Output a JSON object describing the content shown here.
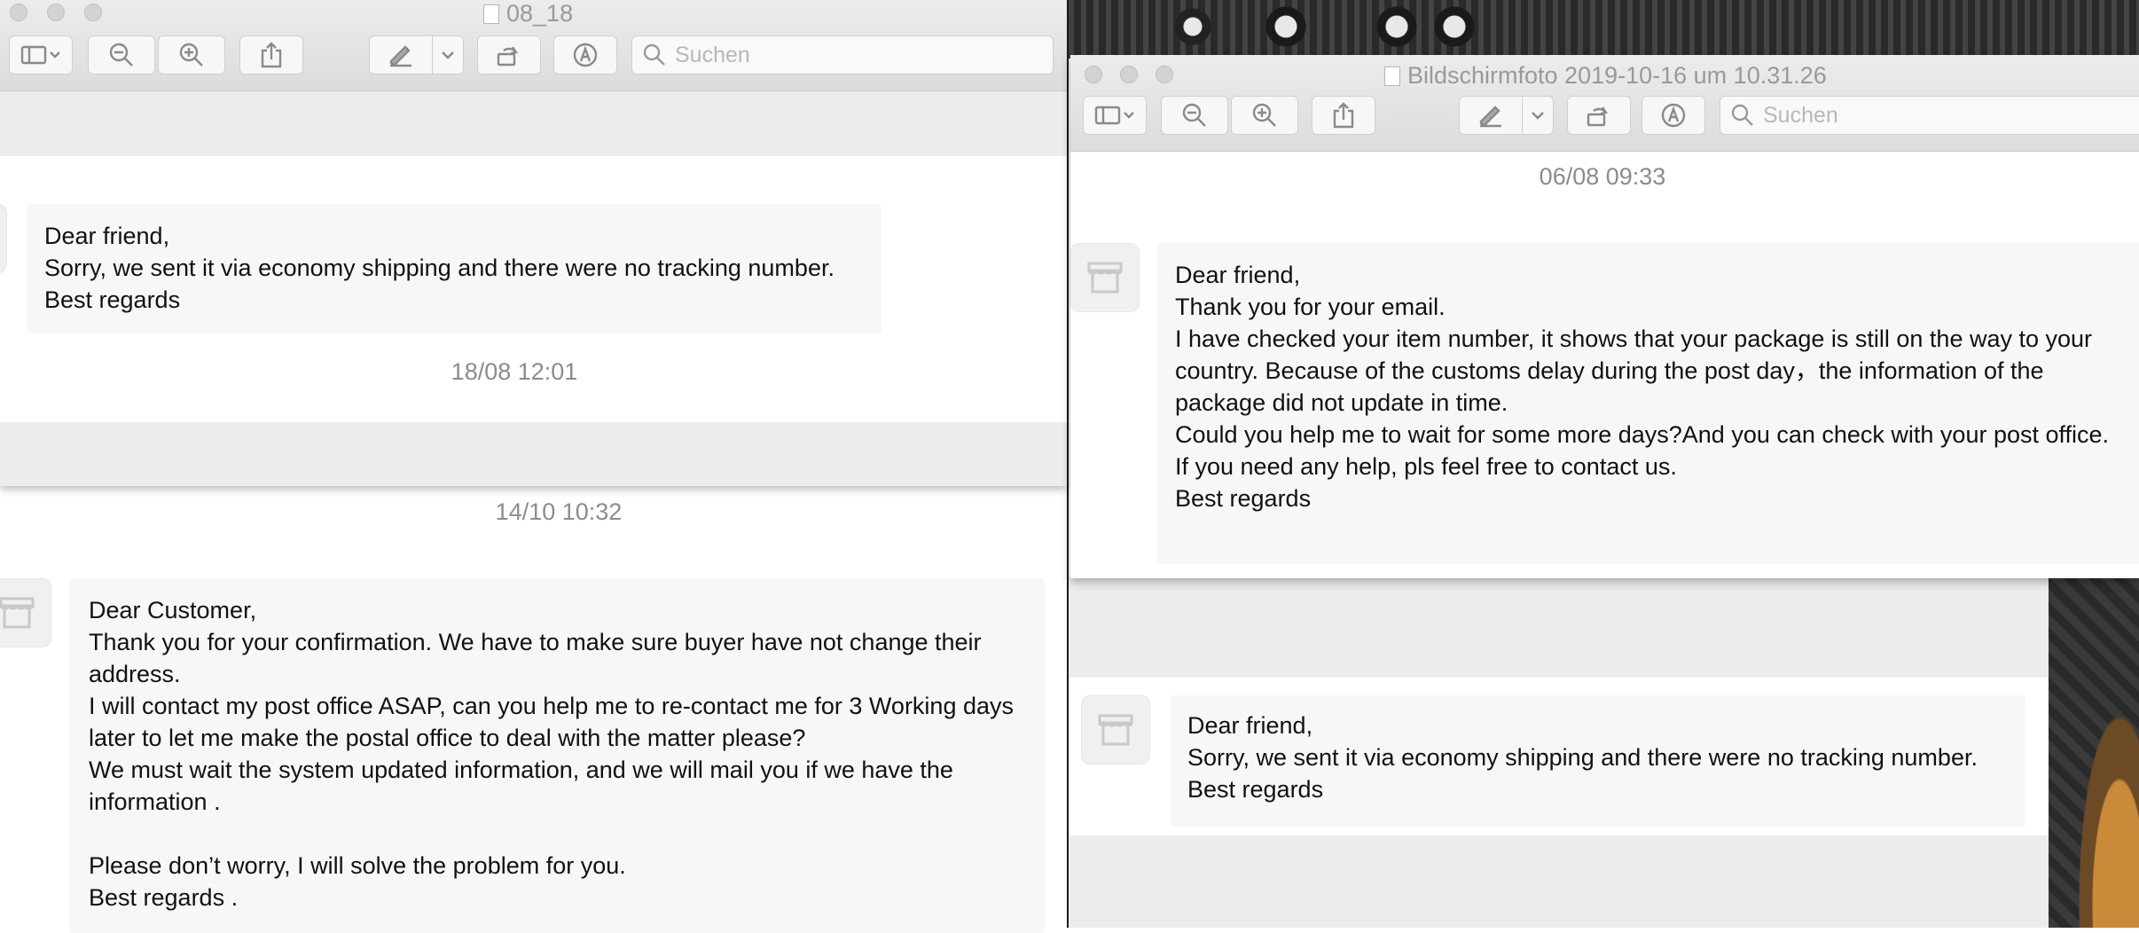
{
  "colors": {
    "window_bg": "#ffffff",
    "bubble_bg": "#f7f7f7",
    "timestamp": "#8c8c8c",
    "toolbar_border": "#cfcfcf"
  },
  "window_left": {
    "title": "08_18",
    "search_placeholder": "Suchen",
    "toolbar_icons": [
      "sidebar-icon",
      "zoom-out-icon",
      "zoom-in-icon",
      "share-icon",
      "markup-pen-icon",
      "rotate-icon",
      "annotate-icon",
      "search-icon"
    ],
    "message": {
      "lines": "Dear friend,\nSorry, we sent it via economy shipping and there were no tracking number.\nBest regards"
    },
    "timestamp": "18/08 12:01"
  },
  "background_left": {
    "timestamp": "14/10 10:32",
    "message": {
      "lines": "Dear Customer,\nThank you for your confirmation. We have to make sure buyer have not change their address.\nI will contact my post office ASAP, can you help me to re-contact me for 3 Working days later to let me make the postal office to deal with the matter please?\nWe must wait the system updated information, and we will mail you if we have the information .\n\nPlease don’t worry, I will solve the problem for you.\nBest regards ."
    }
  },
  "window_right": {
    "title": "Bildschirmfoto 2019-10-16 um 10.31.26",
    "search_placeholder": "Suchen",
    "timestamp": "06/08 09:33",
    "message": {
      "lines": "Dear friend,\nThank you for your email.\nI have checked your item number, it shows that your package is still on the way to your country. Because of the customs delay during the post day，the information of the package did not update in time.\nCould you help me to wait for some more days?And you can check with your post office.\nIf you need any help, pls feel free to contact us.\nBest regards"
    }
  },
  "background_right": {
    "message": {
      "lines": "Dear friend,\nSorry, we sent it via economy shipping and there were no tracking number.\nBest regards"
    }
  }
}
